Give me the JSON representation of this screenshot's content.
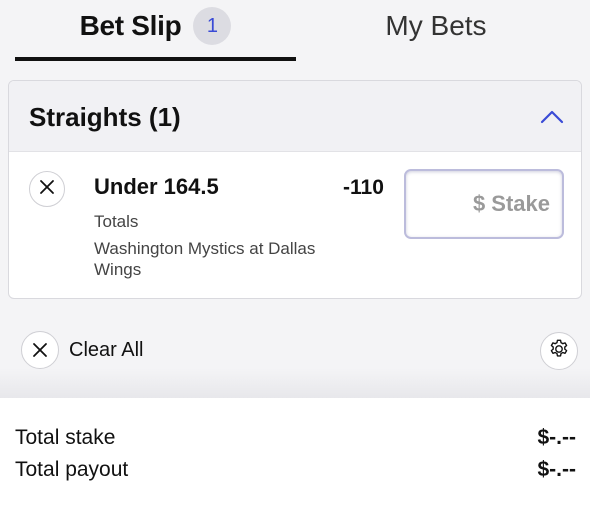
{
  "tabs": {
    "bet_slip": {
      "label": "Bet Slip",
      "count": "1"
    },
    "my_bets": {
      "label": "My Bets"
    }
  },
  "section": {
    "title": "Straights (1)"
  },
  "selection": {
    "name": "Under 164.5",
    "market": "Totals",
    "event": "Washington Mystics at Dallas Wings",
    "odds": "-110",
    "stake_placeholder": "$ Stake",
    "stake_value": ""
  },
  "actions": {
    "clear_all_label": "Clear All"
  },
  "totals": {
    "stake_label": "Total stake",
    "stake_value": "$-.--",
    "payout_label": "Total payout",
    "payout_value": "$-.--"
  },
  "colors": {
    "accent": "#3a4bd6",
    "background": "#f4f4f6",
    "text": "#111111"
  },
  "icons": {
    "remove": "close-icon",
    "collapse": "chevron-up-icon",
    "clear": "close-icon",
    "settings": "gear-icon"
  }
}
